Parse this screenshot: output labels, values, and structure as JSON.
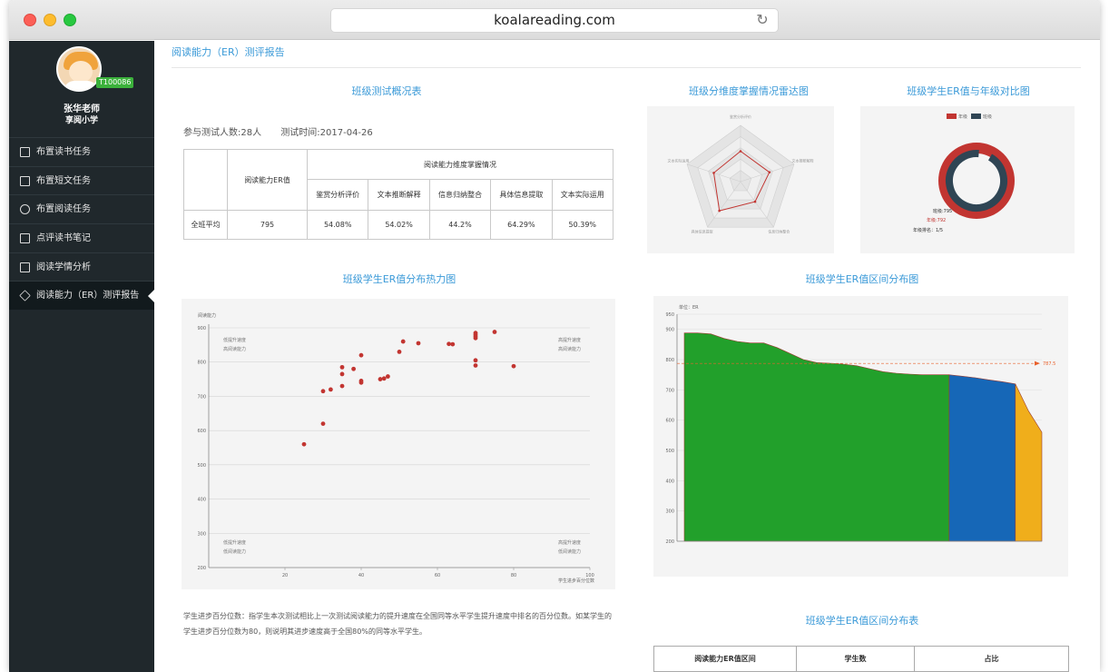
{
  "browser": {
    "url": "koalareading.com"
  },
  "sidebar": {
    "teacher_name": "张华老师",
    "school": "享阅小学",
    "teacher_id": "T100086",
    "items": [
      {
        "label": "布置读书任务",
        "icon": "book-icon"
      },
      {
        "label": "布置短文任务",
        "icon": "grid-icon"
      },
      {
        "label": "布置阅读任务",
        "icon": "eye-icon"
      },
      {
        "label": "点评读书笔记",
        "icon": "edit-icon"
      },
      {
        "label": "阅读学情分析",
        "icon": "calendar-icon"
      },
      {
        "label": "阅读能力（ER）测评报告",
        "icon": "layers-icon",
        "active": true
      }
    ]
  },
  "page": {
    "title": "阅读能力（ER）测评报告"
  },
  "summary": {
    "title": "班级测试概况表",
    "participants_label": "参与测试人数:28人",
    "date_label": "测试时间:2017-04-26",
    "table": {
      "er_header": "阅读能力ER值",
      "dim_header": "阅读能力维度掌握情况",
      "dims": [
        "鉴赏分析评价",
        "文本推断解释",
        "信息归纳整合",
        "具体信息提取",
        "文本实际运用"
      ],
      "row_label": "全班平均",
      "er_value": "795",
      "dim_values": [
        "54.08%",
        "54.02%",
        "44.2%",
        "64.29%",
        "50.39%"
      ]
    }
  },
  "radar": {
    "title": "班级分维度掌握情况雷达图",
    "axes": [
      "鉴赏分析评价",
      "文本推断解释",
      "信息归纳整合",
      "具体信息提取",
      "文本实际运用"
    ],
    "values": [
      54,
      54,
      44,
      64,
      50
    ],
    "max": 100
  },
  "donut": {
    "title": "班级学生ER值与年级对比图",
    "legend": [
      "年级",
      "班级"
    ],
    "colors": {
      "grade": "#c23531",
      "class": "#2f4554"
    },
    "class_label": "班级:795",
    "grade_label": "年级:792",
    "rank_label": "年级排名：1/5"
  },
  "chart_data": [
    {
      "type": "scatter",
      "title": "班级学生ER值分布热力图",
      "ylabel": "阅读能力",
      "xlabel": "学生进步百分位数",
      "xlim": [
        0,
        100
      ],
      "ylim": [
        200,
        900
      ],
      "xticks": [
        20,
        40,
        60,
        80,
        100
      ],
      "yticks": [
        200,
        300,
        400,
        500,
        600,
        700,
        800,
        900
      ],
      "quadrant_labels": {
        "top_left": [
          "低提升速度",
          "高阅读能力"
        ],
        "top_right": [
          "高提升速度",
          "高阅读能力"
        ],
        "bottom_left": [
          "低提升速度",
          "低阅读能力"
        ],
        "bottom_right": [
          "高提升速度",
          "低阅读能力"
        ]
      },
      "points": [
        [
          25,
          560
        ],
        [
          30,
          620
        ],
        [
          30,
          715
        ],
        [
          32,
          720
        ],
        [
          35,
          730
        ],
        [
          35,
          765
        ],
        [
          35,
          785
        ],
        [
          38,
          780
        ],
        [
          40,
          740
        ],
        [
          40,
          745
        ],
        [
          40,
          820
        ],
        [
          45,
          750
        ],
        [
          46,
          752
        ],
        [
          47,
          758
        ],
        [
          50,
          830
        ],
        [
          51,
          860
        ],
        [
          55,
          855
        ],
        [
          63,
          853
        ],
        [
          64,
          852
        ],
        [
          70,
          790
        ],
        [
          70,
          805
        ],
        [
          70,
          870
        ],
        [
          70,
          875
        ],
        [
          70,
          880
        ],
        [
          70,
          885
        ],
        [
          75,
          888
        ],
        [
          80,
          788
        ]
      ],
      "color": "#c23531"
    },
    {
      "type": "area",
      "title": "班级学生ER值区间分布图",
      "ylabel": "单位：ER",
      "ylim": [
        200,
        950
      ],
      "yticks": [
        200,
        300,
        400,
        500,
        600,
        700,
        800,
        900,
        950
      ],
      "reference_line": {
        "value": 787.5,
        "label": "787.5",
        "color": "#e8612c"
      },
      "series": [
        {
          "color": "#22a02b",
          "x": [
            0,
            1,
            2,
            3,
            4,
            5,
            6,
            7,
            8,
            9,
            10,
            11,
            12,
            13,
            14,
            15,
            16,
            17,
            18,
            19,
            20
          ],
          "values": [
            888,
            888,
            885,
            870,
            860,
            855,
            855,
            840,
            820,
            800,
            790,
            788,
            785,
            780,
            770,
            760,
            755,
            752,
            750,
            750,
            750
          ]
        },
        {
          "color": "#1667b7",
          "x": [
            20,
            21,
            22,
            23,
            24,
            25
          ],
          "values": [
            750,
            745,
            740,
            733,
            727,
            720
          ]
        },
        {
          "color": "#f0ae1b",
          "x": [
            25,
            26,
            27
          ],
          "values": [
            720,
            630,
            560
          ]
        }
      ]
    }
  ],
  "note": {
    "line1": "学生进步百分位数：指学生本次测试相比上一次测试阅读能力的提升速度在全国同等水平学生提升速度中排名的百分位数。如某学生的",
    "line2": "学生进步百分位数为80，则说明其进步速度高于全国80%的同等水平学生。"
  },
  "distribution": {
    "title": "班级学生ER值区间分布表",
    "headers": [
      "阅读能力ER值区间",
      "学生数",
      "占比"
    ]
  }
}
